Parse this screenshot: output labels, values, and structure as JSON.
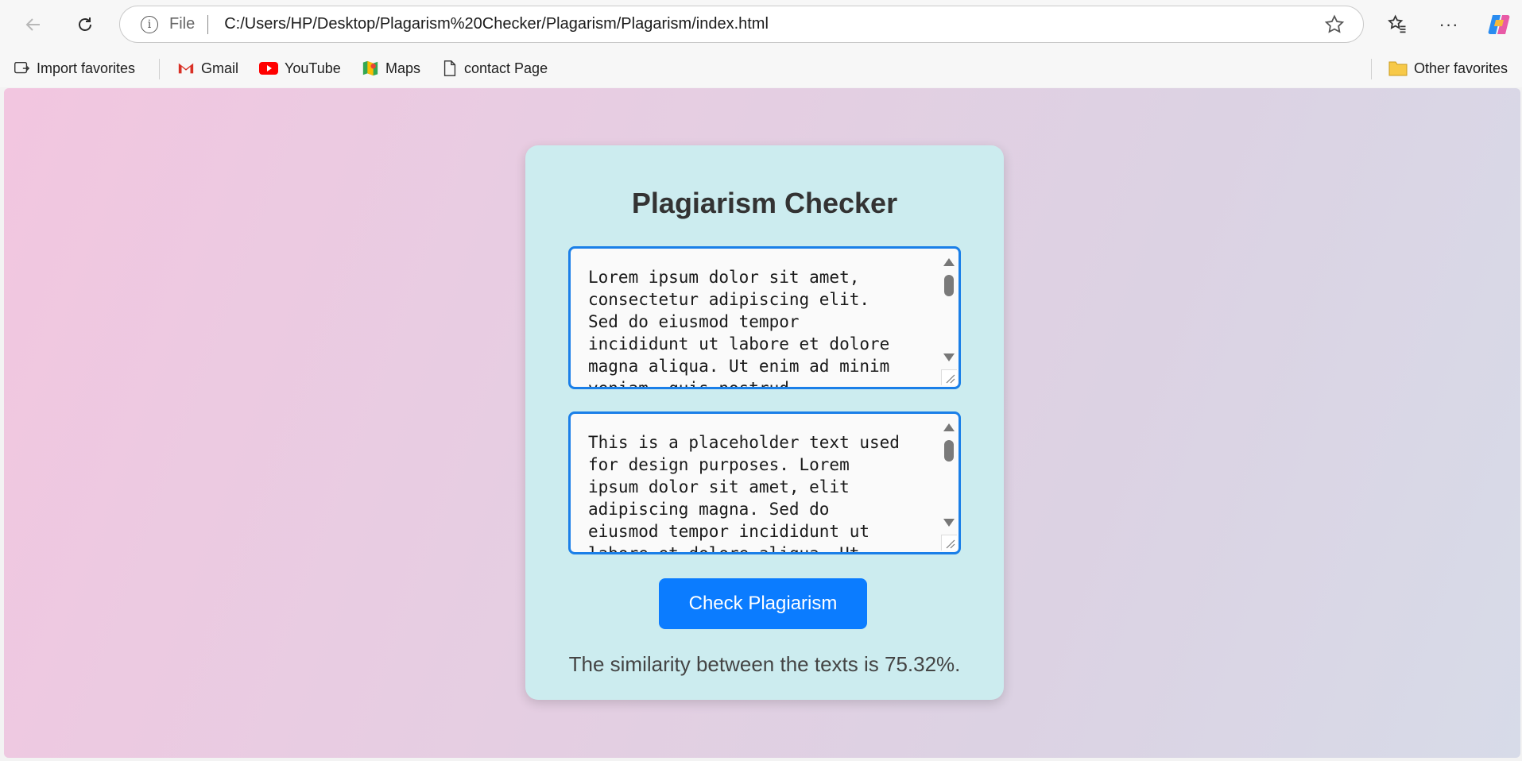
{
  "browser": {
    "address": {
      "scheme_label": "File",
      "url": "C:/Users/HP/Desktop/Plagarism%20Checker/Plagarism/Plagarism/index.html"
    },
    "more_label": "···",
    "icons": [
      "back-arrow-icon",
      "reload-icon",
      "info-icon",
      "star-icon",
      "favorites-icon",
      "copilot-icon"
    ]
  },
  "favorites": {
    "items": [
      {
        "label": "Import favorites",
        "icon": "import-icon"
      },
      {
        "label": "Gmail",
        "icon": "gmail-icon"
      },
      {
        "label": "YouTube",
        "icon": "youtube-icon"
      },
      {
        "label": "Maps",
        "icon": "maps-icon"
      },
      {
        "label": "contact Page",
        "icon": "page-icon"
      }
    ],
    "other": {
      "label": "Other favorites",
      "icon": "folder-icon"
    }
  },
  "app": {
    "title": "Plagiarism Checker",
    "text1": "Lorem ipsum dolor sit amet,\nconsectetur adipiscing elit.\nSed do eiusmod tempor\nincididunt ut labore et dolore\nmagna aliqua. Ut enim ad minim\nveniam, quis nostrud",
    "text2": "This is a placeholder text used\nfor design purposes. Lorem\nipsum dolor sit amet, elit\nadipiscing magna. Sed do\neiusmod tempor incididunt ut\nlabore et dolore aliqua. Ut",
    "button_label": "Check Plagiarism",
    "result": "The similarity between the texts is 75.32%."
  },
  "colors": {
    "accent": "#0b7cff",
    "card_bg": "#ccecef",
    "textarea_border": "#1a7fe8"
  }
}
